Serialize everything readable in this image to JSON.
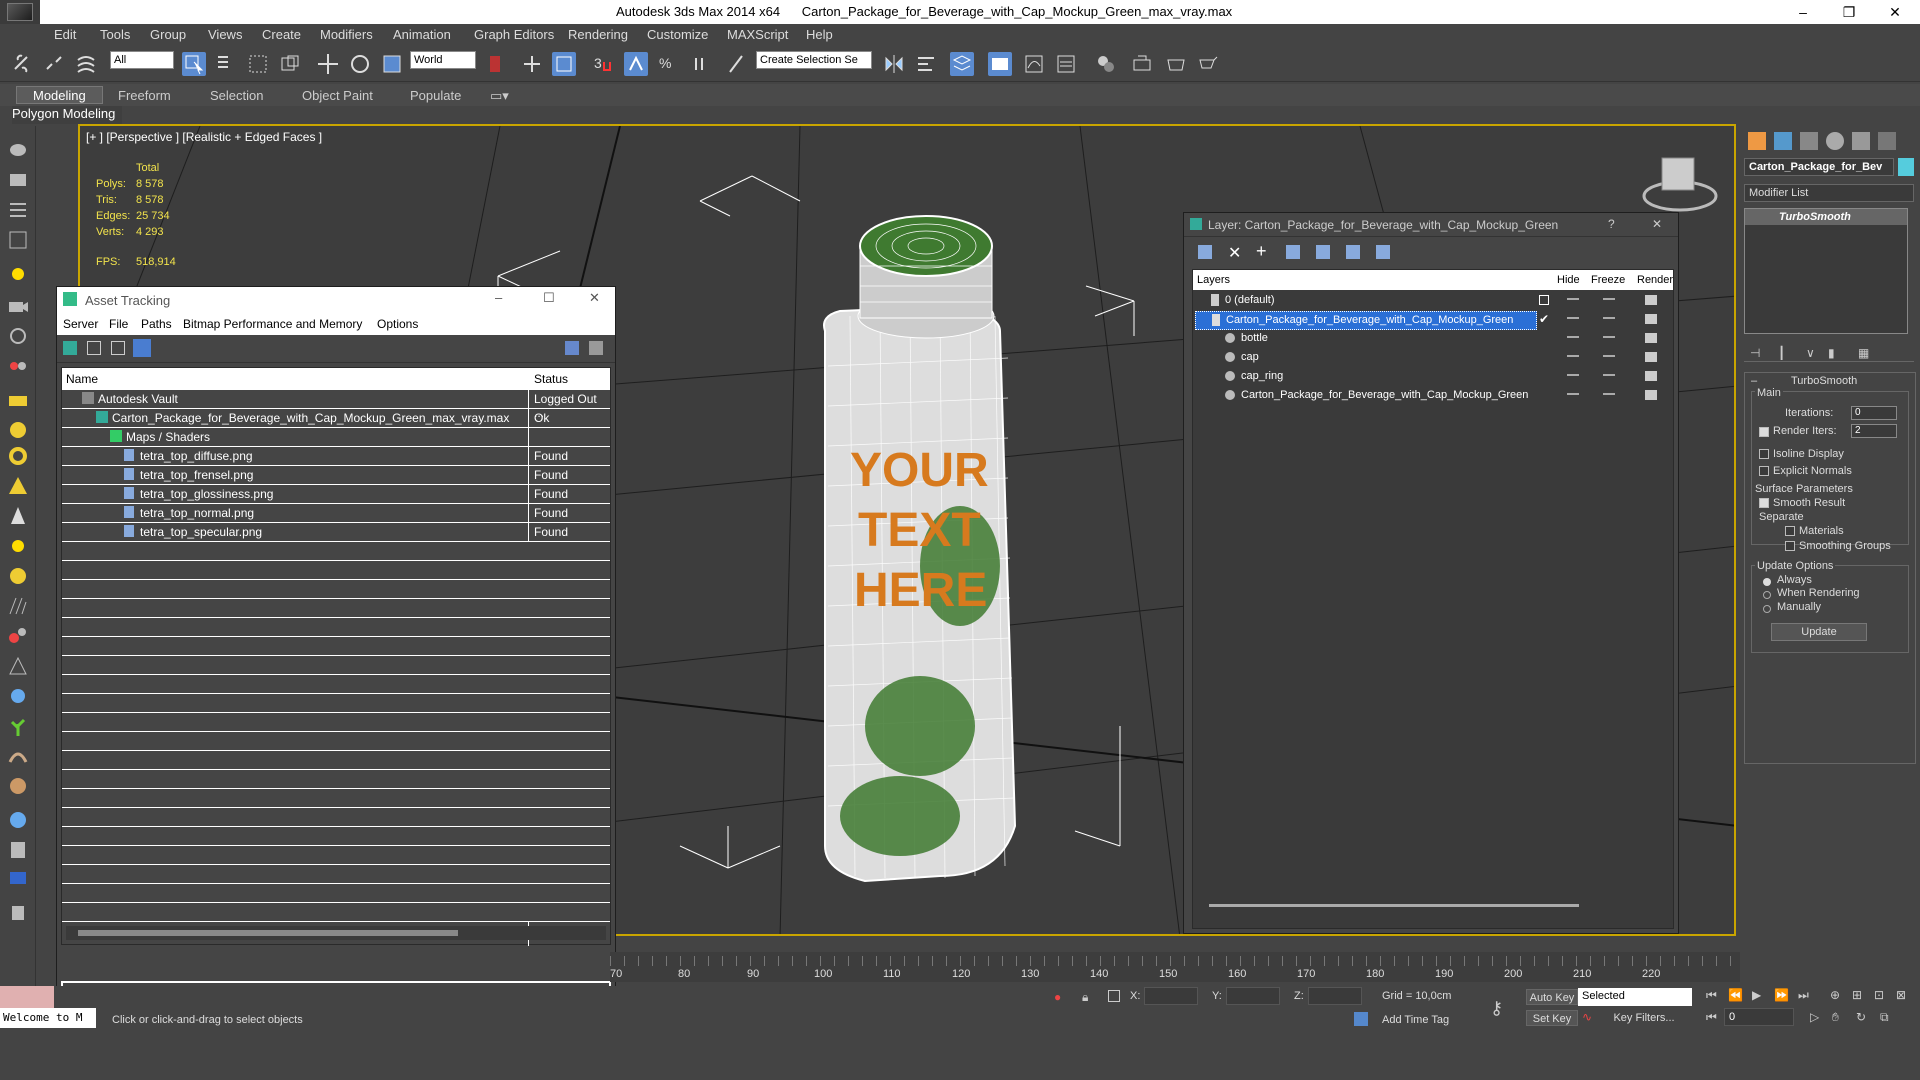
{
  "titlebar": {
    "app": "Autodesk 3ds Max  2014 x64",
    "file": "Carton_Package_for_Beverage_with_Cap_Mockup_Green_max_vray.max",
    "minimize": "–",
    "maximize": "❐",
    "close": "✕"
  },
  "menu": [
    "Edit",
    "Tools",
    "Group",
    "Views",
    "Create",
    "Modifiers",
    "Animation",
    "Graph Editors",
    "Rendering",
    "Customize",
    "MAXScript",
    "Help"
  ],
  "toolbar": {
    "filter": "All",
    "coord": "World",
    "selection_set": "Create Selection Se"
  },
  "ribbon": {
    "tabs": [
      "Modeling",
      "Freeform",
      "Selection",
      "Object Paint",
      "Populate"
    ],
    "panel": "Polygon Modeling"
  },
  "viewport": {
    "label": "[+ ] [Perspective ] [Realistic + Edged Faces ]",
    "stats_header": "Total",
    "stats": [
      {
        "k": "Polys:",
        "v": "8 578"
      },
      {
        "k": "Tris:",
        "v": "8 578"
      },
      {
        "k": "Edges:",
        "v": "25 734"
      },
      {
        "k": "Verts:",
        "v": "4 293"
      }
    ],
    "fps_label": "FPS:",
    "fps": "518,914",
    "product_text": "YOUR TEXT HERE"
  },
  "asset": {
    "title": "Asset Tracking",
    "menu": [
      "Server",
      "File",
      "Paths",
      "Bitmap Performance and Memory",
      "Options"
    ],
    "col_name": "Name",
    "col_status": "Status",
    "rows": [
      {
        "name": "Autodesk Vault",
        "status": "Logged Out ..."
      },
      {
        "name": "Carton_Package_for_Beverage_with_Cap_Mockup_Green_max_vray.max",
        "status": "Ok"
      },
      {
        "name": "Maps / Shaders",
        "status": ""
      },
      {
        "name": "tetra_top_diffuse.png",
        "status": "Found"
      },
      {
        "name": "tetra_top_frensel.png",
        "status": "Found"
      },
      {
        "name": "tetra_top_glossiness.png",
        "status": "Found"
      },
      {
        "name": "tetra_top_normal.png",
        "status": "Found"
      },
      {
        "name": "tetra_top_specular.png",
        "status": "Found"
      }
    ]
  },
  "layer": {
    "title": "Layer: Carton_Package_for_Beverage_with_Cap_Mockup_Green",
    "help": "?",
    "close": "✕",
    "col_layers": "Layers",
    "col_hide": "Hide",
    "col_freeze": "Freeze",
    "col_render": "Render",
    "rows": [
      {
        "name": "0 (default)"
      },
      {
        "name": "Carton_Package_for_Beverage_with_Cap_Mockup_Green"
      },
      {
        "name": "bottle"
      },
      {
        "name": "cap"
      },
      {
        "name": "cap_ring"
      },
      {
        "name": "Carton_Package_for_Beverage_with_Cap_Mockup_Green"
      }
    ]
  },
  "rpanel": {
    "object_name": "Carton_Package_for_Bev",
    "modifier_list": "Modifier List",
    "stack_item": "TurboSmooth",
    "rollout_title": "TurboSmooth",
    "main": "Main",
    "iterations_label": "Iterations:",
    "iterations": "0",
    "render_iters_label": "Render Iters:",
    "render_iters": "2",
    "isoline": "Isoline Display",
    "explicit": "Explicit Normals",
    "surface": "Surface Parameters",
    "smooth": "Smooth Result",
    "separate": "Separate",
    "materials": "Materials",
    "smoothing": "Smoothing Groups",
    "update_opts": "Update Options",
    "always": "Always",
    "when_rendering": "When Rendering",
    "manually": "Manually",
    "update_btn": "Update"
  },
  "timeline": {
    "ticks": [
      "70",
      "80",
      "90",
      "100",
      "110",
      "120",
      "130",
      "140",
      "150",
      "160",
      "170",
      "180",
      "190",
      "200",
      "210",
      "220"
    ]
  },
  "status": {
    "welcome": "Welcome to M",
    "prompt": "Click or click-and-drag to select objects",
    "x": "X:",
    "y": "Y:",
    "z": "Z:",
    "grid": "Grid = 10,0cm",
    "add_time_tag": "Add Time Tag",
    "auto_key": "Auto Key",
    "set_key": "Set Key",
    "key_selected": "Selected",
    "key_filters": "Key Filters...",
    "frame": "0"
  }
}
